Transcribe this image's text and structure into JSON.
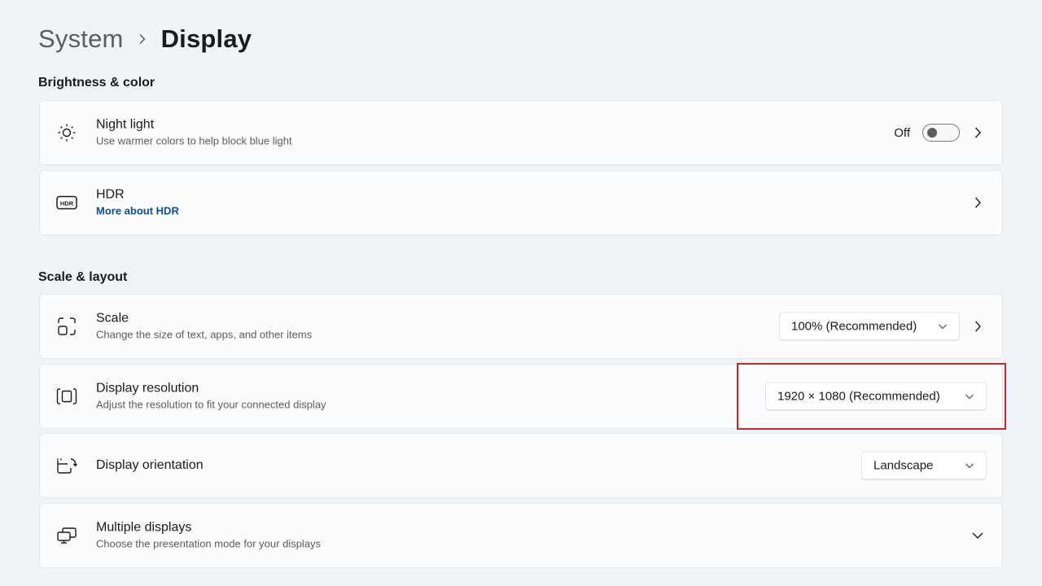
{
  "breadcrumb": {
    "parent": "System",
    "separator_icon": "chevron-right-icon",
    "current": "Display"
  },
  "sections": {
    "brightness": {
      "title": "Brightness & color"
    },
    "scale_layout": {
      "title": "Scale & layout"
    }
  },
  "night_light": {
    "icon": "brightness-sun-icon",
    "title": "Night light",
    "description": "Use warmer colors to help block blue light",
    "toggle_state_label": "Off",
    "toggle_on": false
  },
  "hdr": {
    "icon": "hdr-icon",
    "title": "HDR",
    "link": "More about HDR"
  },
  "scale": {
    "icon": "scale-icon",
    "title": "Scale",
    "description": "Change the size of text, apps, and other items",
    "value": "100% (Recommended)"
  },
  "resolution": {
    "icon": "display-resolution-icon",
    "title": "Display resolution",
    "description": "Adjust the resolution to fit your connected display",
    "value": "1920 × 1080 (Recommended)"
  },
  "orientation": {
    "icon": "display-orientation-icon",
    "title": "Display orientation",
    "value": "Landscape"
  },
  "multiple_displays": {
    "icon": "multiple-displays-icon",
    "title": "Multiple displays",
    "description": "Choose the presentation mode for your displays"
  },
  "colors": {
    "background": "#eff4f8",
    "card": "#fbfcfd",
    "link": "#0a4f98",
    "highlight": "#c42b2b"
  }
}
